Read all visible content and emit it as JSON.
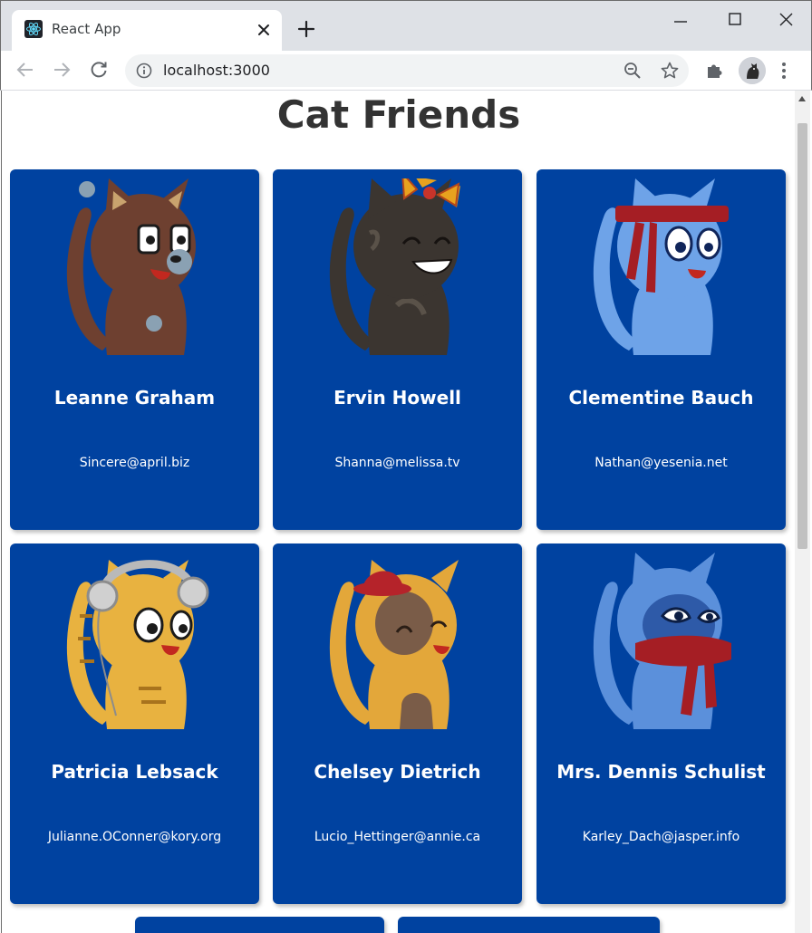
{
  "browser": {
    "tab_title": "React App",
    "url": "localhost:3000"
  },
  "page": {
    "title": "Cat Friends"
  },
  "cards": [
    {
      "name": "Leanne Graham",
      "email": "Sincere@april.biz",
      "cat": "brown-cat"
    },
    {
      "name": "Ervin Howell",
      "email": "Shanna@melissa.tv",
      "cat": "dark-tabby-cat-with-bow"
    },
    {
      "name": "Clementine Bauch",
      "email": "Nathan@yesenia.net",
      "cat": "light-blue-cat-with-headband"
    },
    {
      "name": "Patricia Lebsack",
      "email": "Julianne.OConner@kory.org",
      "cat": "orange-cat-with-headphones"
    },
    {
      "name": "Chelsey Dietrich",
      "email": "Lucio_Hettinger@annie.ca",
      "cat": "orange-cat-with-red-hat"
    },
    {
      "name": "Mrs. Dennis Schulist",
      "email": "Karley_Dach@jasper.info",
      "cat": "blue-cat-with-red-scarf"
    }
  ],
  "colors": {
    "card_bg": "#0042a0",
    "title_text": "#333333",
    "card_text": "#ffffff"
  }
}
